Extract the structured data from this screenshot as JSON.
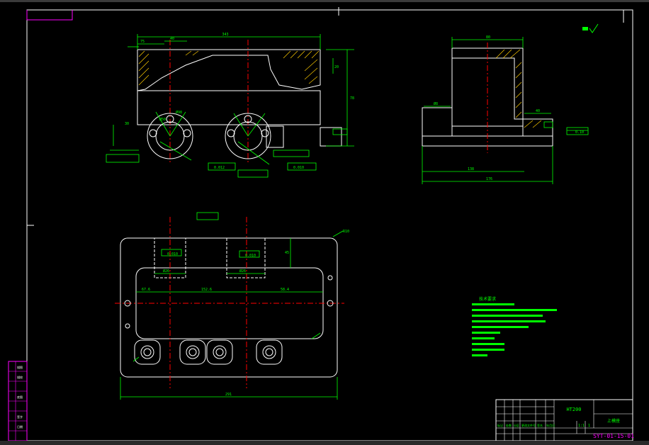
{
  "colors": {
    "background": "#000000",
    "frame": "#ffffff",
    "border_magenta": "#ff00ff",
    "dimension_green": "#00ff00",
    "centerline_red": "#ff0000",
    "text_white": "#ffffff",
    "text_magenta": "#ff00ff",
    "hatch_yellow": "#ffcc00"
  },
  "drawing": {
    "material": "HT200",
    "part_name": "上模座",
    "drawing_number": "SYT-01-15-01",
    "title_top_right": "",
    "tech_requirements_title": "技术要求"
  },
  "dims_front": {
    "overall_width": "343",
    "left_step": "75",
    "slot_width": "40",
    "height": "78",
    "bore_dia": "Ø50",
    "bolt_dia": "Ø98",
    "small_h": "30",
    "right_h": "20",
    "tol_a": "0.012",
    "tol_b": "0.010"
  },
  "dims_side": {
    "top_width": "80",
    "base_width": "176",
    "mid_width": "138",
    "step_h": "40",
    "hole": "Ø8",
    "flatness": "0.10"
  },
  "dims_plan": {
    "overall_length": "291",
    "left_offset": "67.6",
    "center_span": "152.6",
    "right_offset": "58.4",
    "corner_r": "R10",
    "depth": "45",
    "pocket_a": "Ø26",
    "pocket_b": "Ø26",
    "flat_a": "0.010",
    "flat_b": "0.010"
  },
  "title_block": {
    "cells": [
      "标记",
      "处数",
      "分区",
      "更改文件号",
      "签名",
      "年月日"
    ],
    "scale": "1:1",
    "sheet": "1"
  },
  "left_block": {
    "labels": [
      "描图",
      "描校",
      "底图",
      "签字",
      "日期"
    ]
  }
}
